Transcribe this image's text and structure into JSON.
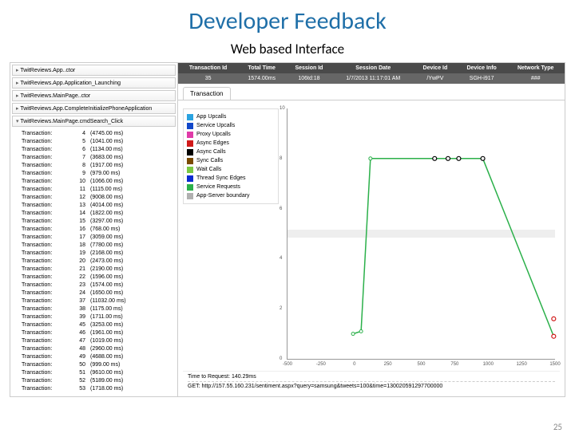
{
  "slide": {
    "title": "Developer Feedback",
    "subtitle": "Web based Interface",
    "page_num": "25"
  },
  "tree": [
    "TwitReviews.App..ctor",
    "TwitReviews.App.Application_Launching",
    "TwitReviews.MainPage..ctor",
    "TwitReviews.App.CompleteInitializePhoneApplication",
    "TwitReviews.MainPage.cmdSearch_Click"
  ],
  "tx_label": "Transaction:",
  "transactions": [
    {
      "i": 4,
      "t": "(4745.00 ms)"
    },
    {
      "i": 5,
      "t": "(1041.00 ms)"
    },
    {
      "i": 6,
      "t": "(1134.00 ms)"
    },
    {
      "i": 7,
      "t": "(3683.00 ms)"
    },
    {
      "i": 8,
      "t": "(1917.00 ms)"
    },
    {
      "i": 9,
      "t": "(979.00 ms)"
    },
    {
      "i": 10,
      "t": "(1066.00 ms)"
    },
    {
      "i": 11,
      "t": "(1115.00 ms)"
    },
    {
      "i": 12,
      "t": "(9008.00 ms)"
    },
    {
      "i": 13,
      "t": "(4014.00 ms)"
    },
    {
      "i": 14,
      "t": "(1822.00 ms)"
    },
    {
      "i": 15,
      "t": "(3297.00 ms)"
    },
    {
      "i": 16,
      "t": "(768.00 ms)"
    },
    {
      "i": 17,
      "t": "(3059.00 ms)"
    },
    {
      "i": 18,
      "t": "(7780.00 ms)"
    },
    {
      "i": 19,
      "t": "(2168.00 ms)"
    },
    {
      "i": 20,
      "t": "(2473.00 ms)"
    },
    {
      "i": 21,
      "t": "(2190.00 ms)"
    },
    {
      "i": 22,
      "t": "(1596.00 ms)"
    },
    {
      "i": 23,
      "t": "(1574.00 ms)"
    },
    {
      "i": 24,
      "t": "(1650.00 ms)"
    },
    {
      "i": 37,
      "t": "(11032.00 ms)"
    },
    {
      "i": 38,
      "t": "(1175.00 ms)"
    },
    {
      "i": 39,
      "t": "(1711.00 ms)"
    },
    {
      "i": 45,
      "t": "(3253.00 ms)"
    },
    {
      "i": 46,
      "t": "(1961.00 ms)"
    },
    {
      "i": 47,
      "t": "(1019.00 ms)"
    },
    {
      "i": 48,
      "t": "(2960.00 ms)"
    },
    {
      "i": 49,
      "t": "(4688.00 ms)"
    },
    {
      "i": 50,
      "t": "(999.00 ms)"
    },
    {
      "i": 51,
      "t": "(9610.00 ms)"
    },
    {
      "i": 52,
      "t": "(5189.00 ms)"
    },
    {
      "i": 53,
      "t": "(1718.00 ms)"
    }
  ],
  "summary": {
    "headers": [
      "Transaction Id",
      "Total Time",
      "Session Id",
      "Session Date",
      "Device Id",
      "Device Info",
      "Network Type"
    ],
    "values": [
      "35",
      "1574.00ms",
      "106td:18",
      "1/7/2013 11:17:01 AM",
      "/YwPV",
      "SGH-i917",
      "###"
    ]
  },
  "tab_label": "Transaction",
  "legend": [
    {
      "c": "#2aa3e0",
      "n": "App Upcalls"
    },
    {
      "c": "#1147c9",
      "n": "Service Upcalls"
    },
    {
      "c": "#e03aa8",
      "n": "Proxy Upcalls"
    },
    {
      "c": "#d11a1a",
      "n": "Async Edges"
    },
    {
      "c": "#000000",
      "n": "Async Calls"
    },
    {
      "c": "#7a4a00",
      "n": "Sync Calls"
    },
    {
      "c": "#7ac943",
      "n": "Wait Calls"
    },
    {
      "c": "#0b2bd1",
      "n": "Thread Sync Edges"
    },
    {
      "c": "#2bb04a",
      "n": "Service Requests"
    },
    {
      "c": "#b0b0b0",
      "n": "App-Server boundary"
    }
  ],
  "request": {
    "time_label": "Time to Request: 140.29ms",
    "get_label": "GET: http://157.55.160.231/sentiment.aspx?query=samsung&tweets=100&time=130020591297700000"
  },
  "chart_data": {
    "type": "line",
    "xlabel": "",
    "ylabel": "",
    "xlim": [
      -500,
      1500
    ],
    "ylim": [
      0,
      10
    ],
    "xticks": [
      -500,
      -250,
      0,
      250,
      500,
      750,
      1000,
      1250,
      1500
    ],
    "yticks": [
      0,
      2,
      4,
      6,
      8,
      10
    ],
    "series": [
      {
        "name": "Wait Calls",
        "color": "#2bb04a",
        "points": [
          [
            -10,
            1.0
          ],
          [
            50,
            1.1
          ],
          [
            120,
            8.0
          ],
          [
            600,
            8.0
          ],
          [
            780,
            8.0
          ],
          [
            960,
            8.0
          ],
          [
            1490,
            0.9
          ]
        ]
      },
      {
        "name": "App-Server boundary",
        "color": "#b0b0b0",
        "points": [
          [
            -500,
            5
          ],
          [
            1500,
            5
          ]
        ],
        "style": "band"
      }
    ],
    "markers": [
      {
        "x": 600,
        "y": 8.0,
        "c": "#000"
      },
      {
        "x": 700,
        "y": 8.0,
        "c": "#000"
      },
      {
        "x": 780,
        "y": 8.0,
        "c": "#000"
      },
      {
        "x": 960,
        "y": 8.0,
        "c": "#000"
      },
      {
        "x": 1490,
        "y": 0.9,
        "c": "#d11a1a"
      },
      {
        "x": 1490,
        "y": 1.6,
        "c": "#d11a1a"
      }
    ]
  }
}
